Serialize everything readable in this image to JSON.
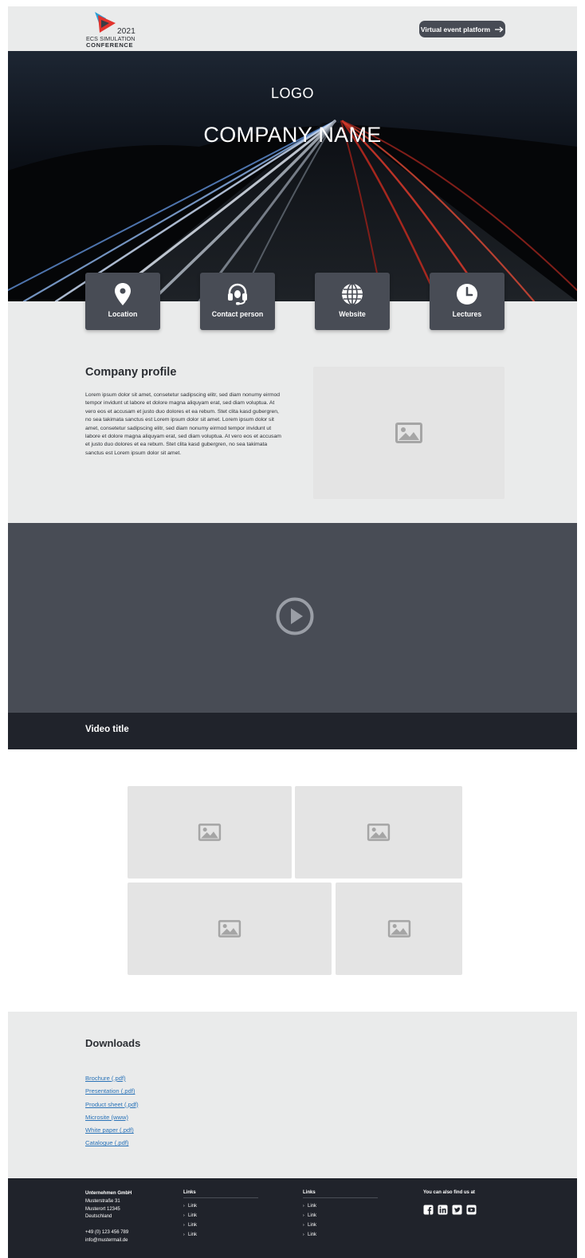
{
  "header": {
    "logo": {
      "year": "2021",
      "line1": "ECS SIMULATION",
      "line2": "CONFERENCE"
    },
    "cta_label": "Virtual event platform",
    "cta_icon": "arrow-right-icon"
  },
  "hero": {
    "logo_text": "LOGO",
    "company_name": "COMPANY NAME"
  },
  "quick_links": [
    {
      "label": "Location",
      "icon": "location-pin-icon"
    },
    {
      "label": "Contact person",
      "icon": "headset-icon"
    },
    {
      "label": "Website",
      "icon": "globe-icon"
    },
    {
      "label": "Lectures",
      "icon": "clock-icon"
    }
  ],
  "profile": {
    "title": "Company profile",
    "text": "Lorem ipsum dolor sit amet, consetetur sadipscing elitr, sed diam nonumy eirmod tempor invidunt ut labore et dolore magna aliquyam erat, sed diam voluptua. At vero eos et accusam et justo duo dolores et ea rebum. Stet clita kasd gubergren, no sea takimata sanctus est Lorem ipsum dolor sit amet. Lorem ipsum dolor sit amet, consetetur sadipscing elitr, sed diam nonumy eirmod tempor invidunt ut labore et dolore magna aliquyam erat, sed diam voluptua. At vero eos et accusam et justo duo dolores et ea rebum. Stet clita kasd gubergren, no sea takimata sanctus est Lorem ipsum dolor sit amet."
  },
  "video": {
    "title": "Video title"
  },
  "downloads": {
    "title": "Downloads",
    "items": [
      "Brochure (.pdf)",
      "Presentation (.pdf)",
      "Product sheet (.pdf)",
      "Microsite (www)",
      "White paper (.pdf)",
      "Catalogue (.pdf)"
    ]
  },
  "footer": {
    "company": {
      "name": "Unternehmen GmbH",
      "street": "Musterstraße 31",
      "city": "Musterort 12345",
      "country": "Deutschland",
      "phone": "+49 (0) 123 456 789",
      "email": "info@mustermail.de"
    },
    "links_col1": {
      "heading": "Links",
      "items": [
        "Link",
        "Link",
        "Link",
        "Link"
      ]
    },
    "links_col2": {
      "heading": "Links",
      "items": [
        "Link",
        "Link",
        "Link",
        "Link"
      ]
    },
    "social": {
      "heading": "You can also find us at",
      "icons": [
        "facebook-icon",
        "linkedin-icon",
        "twitter-icon",
        "youtube-icon"
      ]
    }
  },
  "colors": {
    "tile_bg": "#484c55",
    "dark_bg": "#20232b",
    "light_bg": "#eaebeb",
    "link": "#2a73b8",
    "logo_red": "#e2332d",
    "logo_blue": "#2b9fd6"
  }
}
